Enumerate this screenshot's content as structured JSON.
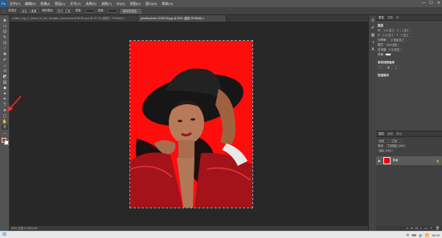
{
  "app": {
    "logo": "Ps"
  },
  "menubar": {
    "items": [
      "文件(F)",
      "编辑(E)",
      "图像(I)",
      "图层(L)",
      "文字(Y)",
      "选择(S)",
      "滤镜(T)",
      "3D(D)",
      "视图(V)",
      "窗口(W)",
      "帮助(H)"
    ],
    "window_controls": [
      "—",
      "☐",
      "✕"
    ]
  },
  "options_bar": {
    "items": [
      "新选区",
      "羽化: 0 像素",
      "消除锯齿",
      "样式: 正常",
      "宽度:",
      "高度:"
    ],
    "select_mask_button": "选择并遮住..."
  },
  "tabs": [
    {
      "label": "coffee_ring_2_elbow_to_the_temples_marvelous-9HHHE.psd @ 33.3% (图层1, RGB/8#) ×",
      "active": false
    },
    {
      "label": "pexels-photo-1196716.jpg @ 50% (图层 RGB/8#) ×",
      "active": true
    }
  ],
  "toolbar": {
    "tools": [
      {
        "name": "move-tool-icon",
        "glyph": "✥"
      },
      {
        "name": "marquee-tool-icon",
        "glyph": "▭"
      },
      {
        "name": "lasso-tool-icon",
        "glyph": "ʘ"
      },
      {
        "name": "quick-select-tool-icon",
        "glyph": "✎"
      },
      {
        "name": "crop-tool-icon",
        "glyph": "⊡"
      },
      {
        "name": "eyedropper-tool-icon",
        "glyph": "⁄"
      },
      {
        "name": "healing-brush-tool-icon",
        "glyph": "✚"
      },
      {
        "name": "brush-tool-icon",
        "glyph": "✐"
      },
      {
        "name": "clone-stamp-tool-icon",
        "glyph": "⊥"
      },
      {
        "name": "history-brush-tool-icon",
        "glyph": "↺"
      },
      {
        "name": "eraser-tool-icon",
        "glyph": "◩"
      },
      {
        "name": "gradient-tool-icon",
        "glyph": "▤"
      },
      {
        "name": "blur-tool-icon",
        "glyph": "◆"
      },
      {
        "name": "dodge-tool-icon",
        "glyph": "●"
      },
      {
        "name": "pen-tool-icon",
        "glyph": "✒"
      },
      {
        "name": "type-tool-icon",
        "glyph": "T"
      },
      {
        "name": "path-select-tool-icon",
        "glyph": "➤"
      },
      {
        "name": "shape-tool-icon",
        "glyph": "▢"
      },
      {
        "name": "hand-tool-icon",
        "glyph": "✋"
      },
      {
        "name": "zoom-tool-icon",
        "glyph": "⚲"
      },
      {
        "name": "more-tools-icon",
        "glyph": "…"
      }
    ],
    "foreground_color": "#ff0000",
    "background_color": "#ffffff"
  },
  "status_bar": {
    "text": "50% 文档:3.1M/3.1M"
  },
  "properties_panel": {
    "tabs": [
      "属性",
      "调整",
      "库"
    ],
    "section_layer": "图层",
    "w_label": "W",
    "w_value": "3.16 英寸",
    "h_label": "H",
    "h_value": "4.23 英寸",
    "x_label": "X",
    "x_value": "0 英寸",
    "y_label": "Y",
    "y_value": "0 英寸",
    "resolution_label": "分辨率:",
    "resolution_value": "72 像素/英寸",
    "mode_label": "模式",
    "mode_value": "RGB 颜色",
    "depth_label": "位深度",
    "depth_value": "8 位/通道",
    "background_label": "背景",
    "section_guides": "参考线和画布",
    "section_quick": "快速操作"
  },
  "layers_panel": {
    "tabs": [
      "图层",
      "通道",
      "路径"
    ],
    "kind_label": "类型",
    "blend_mode": "正常",
    "opacity_label": "不透明度: 100%",
    "lock_label": "锁定:",
    "fill_label": "填充: 100%",
    "layer_name": "背景"
  },
  "taskbar": {
    "tray_items": [
      "中",
      "⌨",
      "🔊",
      "📶"
    ],
    "time": "16:29"
  },
  "colors": {
    "canvas_background": "#ff0d0d",
    "accent_arrow": "#ff2a2a"
  }
}
